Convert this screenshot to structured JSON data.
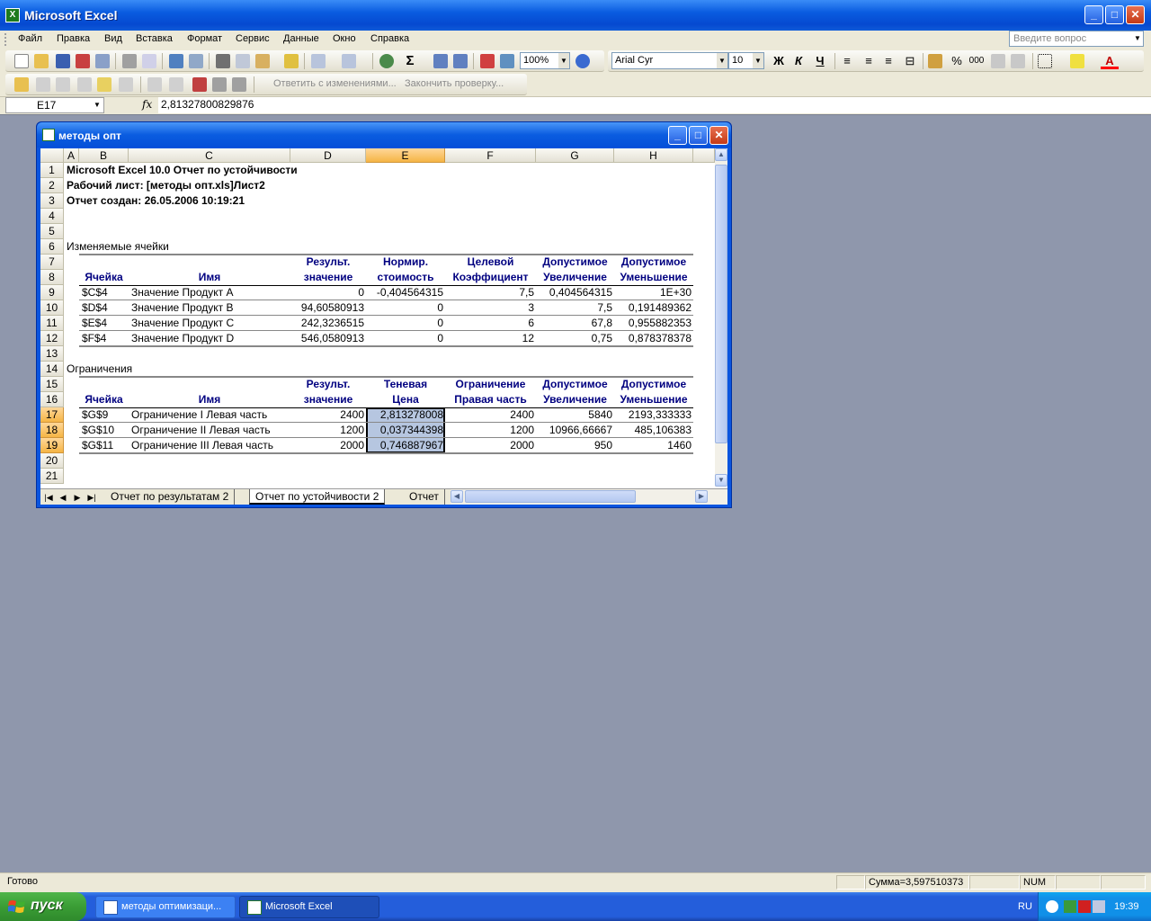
{
  "app": {
    "title": "Microsoft Excel"
  },
  "menu": {
    "items": [
      "Файл",
      "Правка",
      "Вид",
      "Вставка",
      "Формат",
      "Сервис",
      "Данные",
      "Окно",
      "Справка"
    ],
    "help_placeholder": "Введите вопрос"
  },
  "toolbar": {
    "zoom": "100%",
    "font": "Arial Cyr",
    "size": "10",
    "review_reply": "Ответить с изменениями...",
    "review_end": "Закончить проверку...",
    "bold": "Ж",
    "italic": "К",
    "underline": "Ч",
    "percent": "%",
    "thousands": "000",
    "sigma": "Σ"
  },
  "formula_bar": {
    "cell_ref": "E17",
    "fx": "fx",
    "value": "2,81327800829876"
  },
  "workbook": {
    "title": "методы опт"
  },
  "columns": [
    "A",
    "B",
    "C",
    "D",
    "E",
    "F",
    "G",
    "H"
  ],
  "rows": [
    "1",
    "2",
    "3",
    "4",
    "5",
    "6",
    "7",
    "8",
    "9",
    "10",
    "11",
    "12",
    "13",
    "14",
    "15",
    "16",
    "17",
    "18",
    "19",
    "20",
    "21"
  ],
  "report": {
    "line1": "Microsoft Excel 10.0 Отчет по устойчивости",
    "line2": "Рабочий лист: [методы опт.xls]Лист2",
    "line3": "Отчет создан: 26.05.2006 10:19:21",
    "section1": "Изменяемые ячейки",
    "section2": "Ограничения"
  },
  "changing": {
    "header_top": [
      "",
      "",
      "Результ.",
      "Нормир.",
      "Целевой",
      "Допустимое",
      "Допустимое"
    ],
    "header_bottom": [
      "Ячейка",
      "Имя",
      "значение",
      "стоимость",
      "Коэффициент",
      "Увеличение",
      "Уменьшение"
    ],
    "rows": [
      [
        "$C$4",
        "Значение Продукт A",
        "0",
        "-0,404564315",
        "7,5",
        "0,404564315",
        "1E+30"
      ],
      [
        "$D$4",
        "Значение Продукт B",
        "94,60580913",
        "0",
        "3",
        "7,5",
        "0,191489362"
      ],
      [
        "$E$4",
        "Значение Продукт C",
        "242,3236515",
        "0",
        "6",
        "67,8",
        "0,955882353"
      ],
      [
        "$F$4",
        "Значение Продукт D",
        "546,0580913",
        "0",
        "12",
        "0,75",
        "0,878378378"
      ]
    ]
  },
  "constraints": {
    "header_top": [
      "",
      "",
      "Результ.",
      "Теневая",
      "Ограничение",
      "Допустимое",
      "Допустимое"
    ],
    "header_bottom": [
      "Ячейка",
      "Имя",
      "значение",
      "Цена",
      "Правая часть",
      "Увеличение",
      "Уменьшение"
    ],
    "rows": [
      [
        "$G$9",
        "Ограничение I Левая часть",
        "2400",
        "2,813278008",
        "2400",
        "5840",
        "2193,333333"
      ],
      [
        "$G$10",
        "Ограничение II Левая часть",
        "1200",
        "0,037344398",
        "1200",
        "10966,66667",
        "485,106383"
      ],
      [
        "$G$11",
        "Ограничение III Левая часть",
        "2000",
        "0,746887967",
        "2000",
        "950",
        "1460"
      ]
    ]
  },
  "sheet_tabs": [
    "Отчет по результатам 2",
    "Отчет по устойчивости 2",
    "Отчет"
  ],
  "status": {
    "ready": "Готово",
    "sum": "Сумма=3,597510373",
    "num": "NUM"
  },
  "taskbar": {
    "start": "пуск",
    "task1": "методы оптимизаци...",
    "task2": "Microsoft Excel",
    "lang": "RU",
    "time": "19:39"
  },
  "colors": {
    "accent": "#0a55df",
    "selected_header": "#f5b545",
    "workspace": "#8f97ac",
    "header_text": "#000080"
  }
}
